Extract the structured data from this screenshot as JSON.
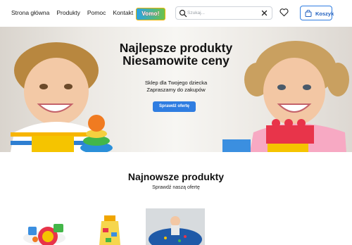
{
  "header": {
    "nav": [
      "Strona główna",
      "Produkty",
      "Pomoc",
      "Kontakt"
    ],
    "logo_text": "Vomo!",
    "search_placeholder": "Szukaj...",
    "cart_label": "Koszyk"
  },
  "hero": {
    "title_line1": "Najlepsze produkty",
    "title_line2": "Niesamowite ceny",
    "subtitle_line1": "Sklep dla Twojego dziecka",
    "subtitle_line2": "Zapraszamy do zakupów",
    "cta": "Sprawdź ofertę"
  },
  "latest": {
    "title": "Najnowsze produkty",
    "subtitle": "Sprawdź naszą ofertę"
  },
  "colors": {
    "accent": "#2f7de1",
    "text": "#111111"
  }
}
